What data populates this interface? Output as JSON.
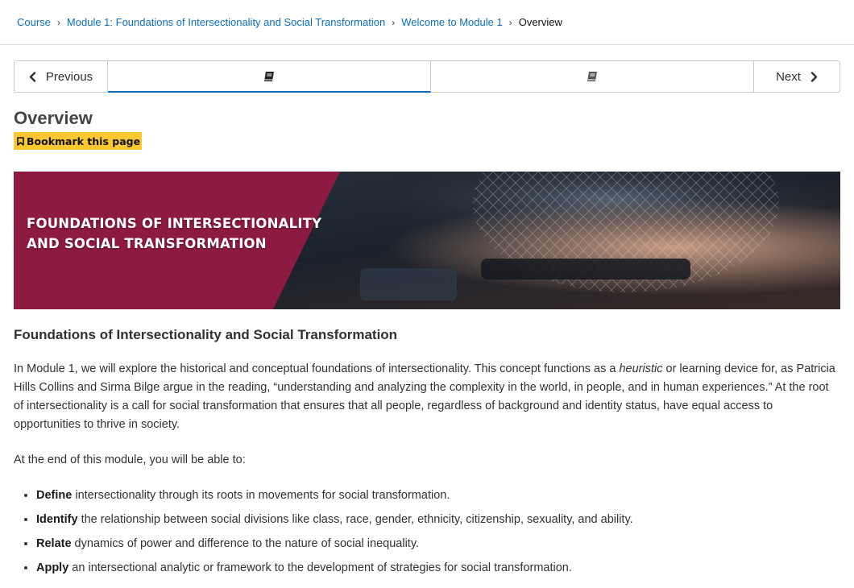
{
  "breadcrumb": {
    "items": [
      "Course",
      "Module 1: Foundations of Intersectionality and Social Transformation",
      "Welcome to Module 1"
    ],
    "current": "Overview"
  },
  "sequence_nav": {
    "previous_label": "Previous",
    "next_label": "Next",
    "units": [
      "book-icon",
      "book-icon"
    ]
  },
  "page": {
    "title": "Overview",
    "bookmark_label": "Bookmark this page"
  },
  "banner": {
    "line1": "FOUNDATIONS OF INTERSECTIONALITY",
    "line2": "AND SOCIAL TRANSFORMATION",
    "accent_color": "#8d1a42"
  },
  "content": {
    "heading": "Foundations of Intersectionality and Social Transformation",
    "intro": {
      "before": "In Module 1, we will explore the historical and conceptual foundations of intersectionality. This concept functions as a ",
      "emphasis": "heuristic",
      "after": " or learning device for, as Patricia Hills Collins and Sirma Bilge argue in the reading, “understanding and analyzing the complexity in the world, in people, and in human experiences.” At the root of intersectionality is a call for social transformation that ensures that all people, regardless of background and identity status, have equal access to opportunities to thrive in society."
    },
    "objectives_lead": "At the end of this module, you will be able to:",
    "objectives": [
      {
        "verb": "Define",
        "text": " intersectionality through its roots in movements for social transformation."
      },
      {
        "verb": "Identify",
        "text": " the relationship between social divisions like class, race, gender, ethnicity, citizenship, sexuality, and ability."
      },
      {
        "verb": "Relate",
        "text": " dynamics of power and difference to the nature of social inequality."
      },
      {
        "verb": "Apply",
        "text": " an intersectional analytic or framework to the development of strategies for social transformation."
      }
    ]
  },
  "colors": {
    "link": "#0a6ebd",
    "bookmark_bg": "#f9c72f"
  }
}
